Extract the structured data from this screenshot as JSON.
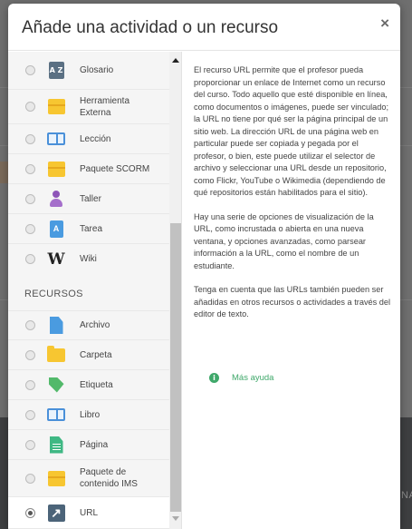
{
  "modal": {
    "title": "Añade una actividad o un recurso",
    "close_label": "×"
  },
  "activities": [
    {
      "label": "Glosario",
      "icon": "glossary-icon"
    },
    {
      "label": "Herramienta Externa",
      "icon": "external-tool-icon"
    },
    {
      "label": "Lección",
      "icon": "lesson-icon"
    },
    {
      "label": "Paquete SCORM",
      "icon": "scorm-package-icon"
    },
    {
      "label": "Taller",
      "icon": "workshop-icon"
    },
    {
      "label": "Tarea",
      "icon": "assignment-icon"
    },
    {
      "label": "Wiki",
      "icon": "wiki-icon"
    }
  ],
  "resources_section": {
    "title": "RECURSOS"
  },
  "resources": [
    {
      "label": "Archivo",
      "icon": "file-icon"
    },
    {
      "label": "Carpeta",
      "icon": "folder-icon"
    },
    {
      "label": "Etiqueta",
      "icon": "label-icon"
    },
    {
      "label": "Libro",
      "icon": "book-icon"
    },
    {
      "label": "Página",
      "icon": "page-icon"
    },
    {
      "label": "Paquete de contenido IMS",
      "icon": "ims-package-icon"
    },
    {
      "label": "URL",
      "icon": "url-icon",
      "selected": true
    }
  ],
  "icon_glyphs": {
    "glossary": "A Z",
    "assignment": "A",
    "wiki": "W",
    "url": "↗",
    "info": "i"
  },
  "description": {
    "paragraphs": [
      "El recurso URL permite que el profesor pueda proporcionar un enlace de Internet como un recurso del curso. Todo aquello que esté disponible en línea, como documentos o imágenes, puede ser vinculado; la URL no tiene por qué ser la página principal de un sitio web. La dirección URL de una página web en particular puede ser copiada y pegada por el profesor, o bien, este puede utilizar el selector de archivo y seleccionar una URL desde un repositorio, como Flickr, YouTube o Wikimedia (dependiendo de qué repositorios están habilitados para el sitio).",
      "Hay una serie de opciones de visualización de la URL, como incrustada o abierta en una nueva ventana, y opciones avanzadas, como parsear información a la URL, como el nombre de un estudiante.",
      "Tenga en cuenta que las URLs también pueden ser añadidas en otros recursos o actividades a través del editor de texto."
    ],
    "help_link": "Más ayuda"
  },
  "background": {
    "edge_text": "NA"
  },
  "colors": {
    "accent_green": "#3fa86a",
    "url_icon": "#4c6479",
    "overlay": "#6f6f6f"
  }
}
